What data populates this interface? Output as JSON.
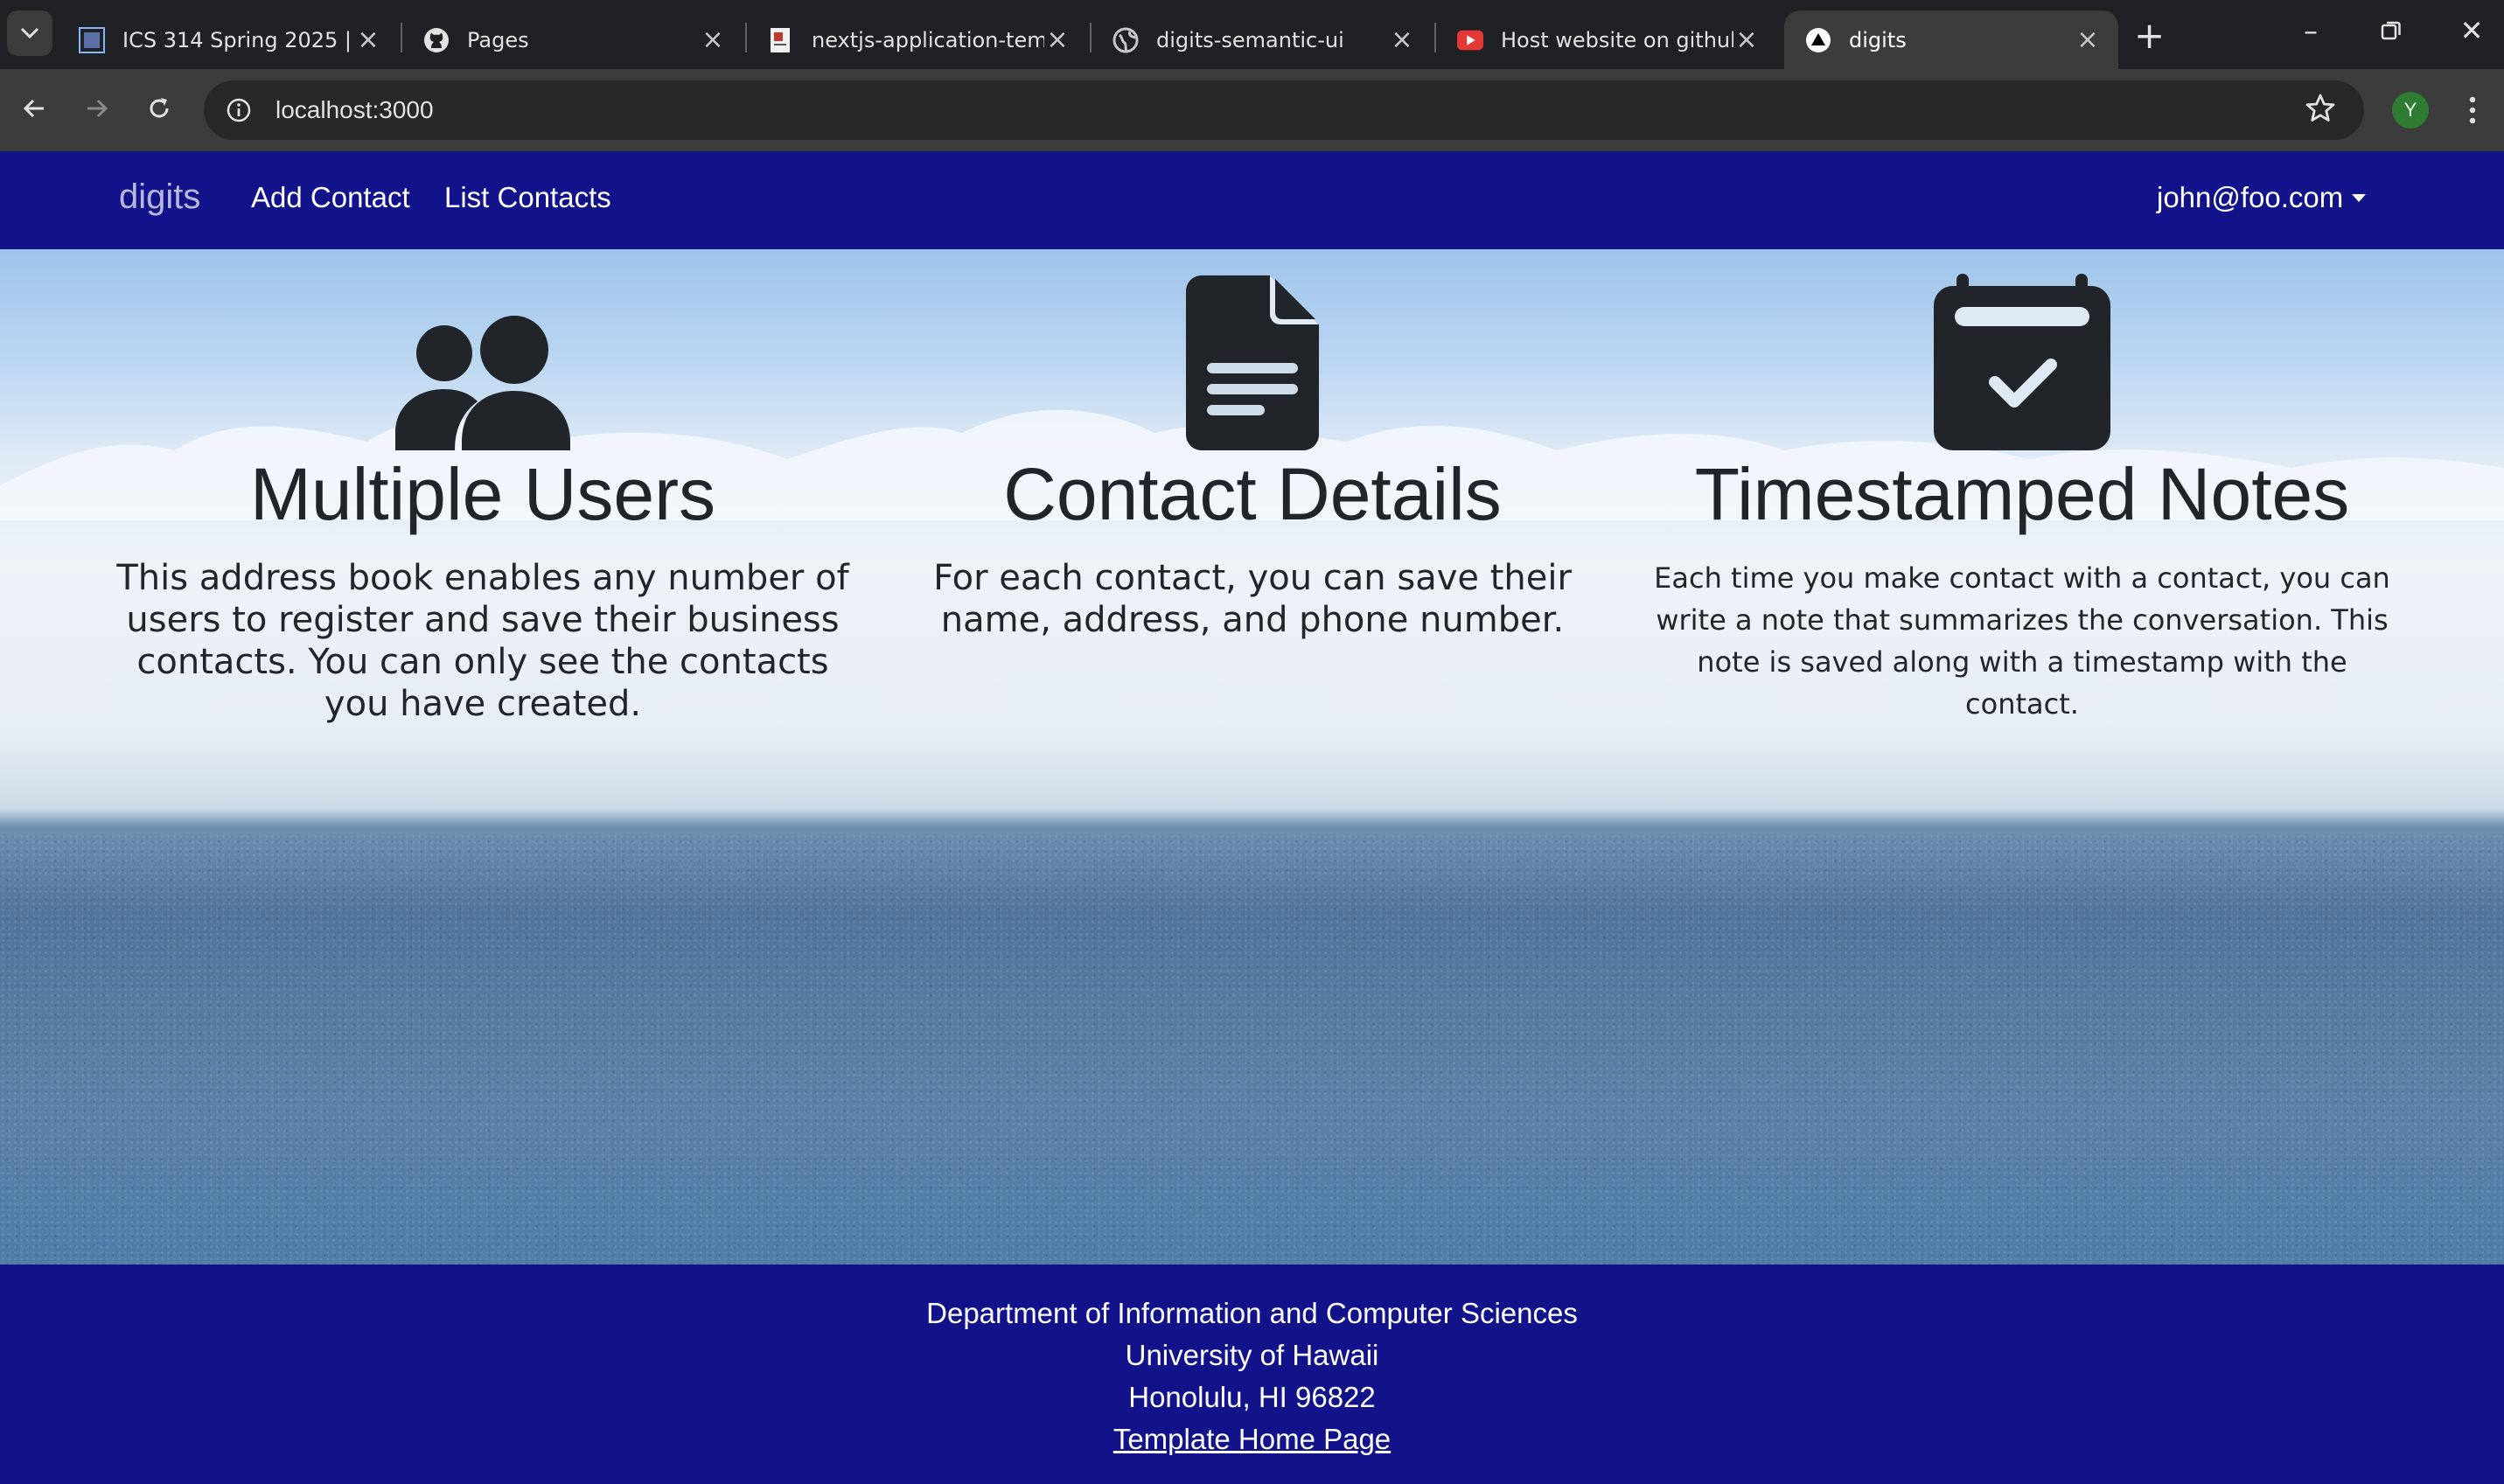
{
  "browser": {
    "tabs": [
      {
        "title": "ICS 314 Spring 2025 | ES",
        "icon": "course-favicon"
      },
      {
        "title": "Pages",
        "icon": "github-icon"
      },
      {
        "title": "nextjs-application-temp",
        "icon": "doc-favicon"
      },
      {
        "title": "digits-semantic-ui",
        "icon": "globe-icon"
      },
      {
        "title": "Host website on github",
        "icon": "youtube-icon"
      },
      {
        "title": "digits",
        "icon": "nextjs-icon",
        "active": true
      }
    ],
    "url": "localhost:3000",
    "profile_initial": "Y"
  },
  "navbar": {
    "brand": "digits",
    "links": [
      "Add Contact",
      "List Contacts"
    ],
    "user": "john@foo.com"
  },
  "features": [
    {
      "icon": "users-icon",
      "title": "Multiple Users",
      "text": "This address book enables any number of users to register and save their business contacts. You can only see the contacts you have created."
    },
    {
      "icon": "file-icon",
      "title": "Contact Details",
      "text": "For each contact, you can save their name, address, and phone number."
    },
    {
      "icon": "calendar-check-icon",
      "title": "Timestamped Notes",
      "text": "Each time you make contact with a contact, you can write a note that summarizes the conversation. This note is saved along with a timestamp with the contact."
    }
  ],
  "footer": {
    "line1": "Department of Information and Computer Sciences",
    "line2": "University of Hawaii",
    "line3": "Honolulu, HI 96822",
    "link": "Template Home Page"
  },
  "colors": {
    "navbar": "#12128a",
    "icon": "#212529"
  }
}
